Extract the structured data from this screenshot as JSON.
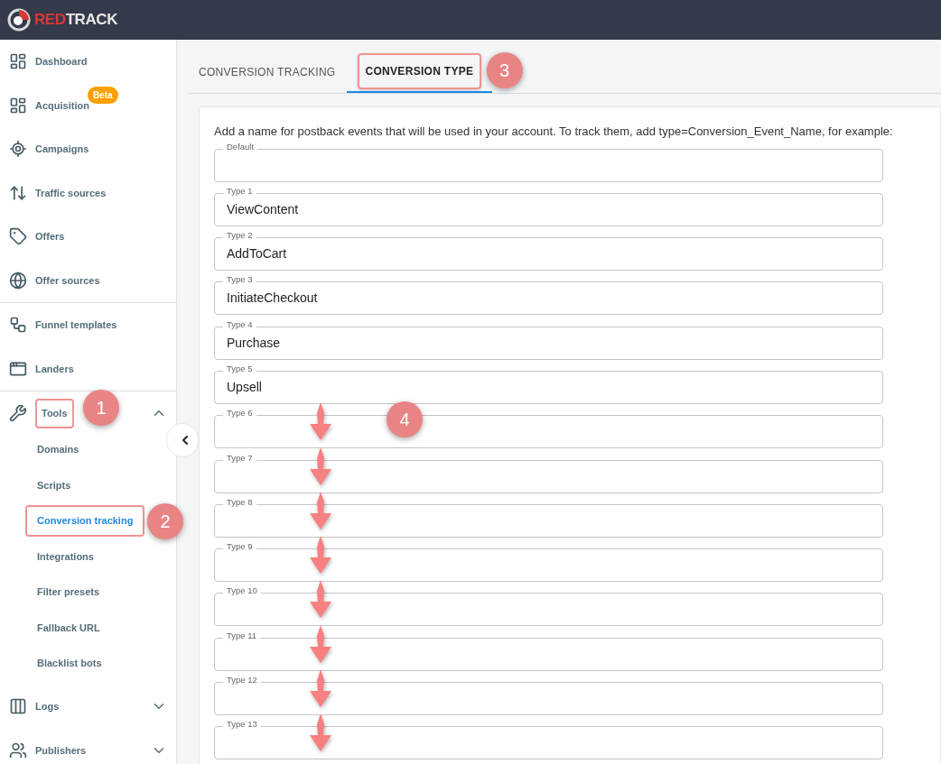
{
  "logo": [
    "RED",
    "TRACK"
  ],
  "sidebar": {
    "sections": [
      {
        "items": [
          {
            "label": "Dashboard",
            "selected": false
          },
          {
            "label": "Acquisition",
            "badge": "Beta",
            "selected": false
          },
          {
            "label": "Campaigns",
            "selected": false
          },
          {
            "label": "Traffic sources",
            "selected": false
          },
          {
            "label": "Offers",
            "selected": false
          },
          {
            "label": "Offer sources",
            "selected": false
          }
        ]
      },
      {
        "items": [
          {
            "label": "Funnel templates",
            "selected": false
          },
          {
            "label": "Landers",
            "selected": false
          }
        ]
      },
      {
        "items": [
          {
            "label": "Tools",
            "selected": false,
            "expanded": true,
            "highlighted": true,
            "callout": "1",
            "children": [
              {
                "label": "Domains",
                "selected": false
              },
              {
                "label": "Scripts",
                "selected": false
              },
              {
                "label": "Conversion tracking",
                "selected": true,
                "highlighted": true,
                "callout": "2"
              },
              {
                "label": "Integrations",
                "selected": false
              },
              {
                "label": "Filter presets",
                "selected": false
              },
              {
                "label": "Fallback URL",
                "selected": false
              },
              {
                "label": "Blacklist bots",
                "selected": false
              }
            ]
          },
          {
            "label": "Logs",
            "selected": false,
            "expanded": false
          },
          {
            "label": "Publishers",
            "selected": false,
            "expanded": false
          }
        ]
      }
    ]
  },
  "tabs": [
    {
      "label": "CONVERSION TRACKING",
      "selected": false
    },
    {
      "label": "CONVERSION TYPE",
      "selected": true,
      "highlighted": true,
      "callout": "3"
    }
  ],
  "intro": "Add a name for postback events that will be used in your account. To track them, add type=Conversion_Event_Name, for example:",
  "fields": [
    {
      "label": "Default",
      "marked": false
    },
    {
      "label": "Type 1",
      "value": "ViewContent",
      "marked": false
    },
    {
      "label": "Type 2",
      "value": "AddToCart",
      "marked": false
    },
    {
      "label": "Type 3",
      "value": "InitiateCheckout",
      "marked": false
    },
    {
      "label": "Type 4",
      "value": "Purchase",
      "marked": false
    },
    {
      "label": "Type 5",
      "value": "Upsell",
      "marked": false
    },
    {
      "label": "Type 6",
      "marked": true,
      "callout": "4"
    },
    {
      "label": "Type 7",
      "marked": true
    },
    {
      "label": "Type 8",
      "marked": true
    },
    {
      "label": "Type 9",
      "marked": true
    },
    {
      "label": "Type 10",
      "marked": true
    },
    {
      "label": "Type 11",
      "marked": true
    },
    {
      "label": "Type 12",
      "marked": true
    },
    {
      "label": "Type 13",
      "marked": true
    }
  ]
}
